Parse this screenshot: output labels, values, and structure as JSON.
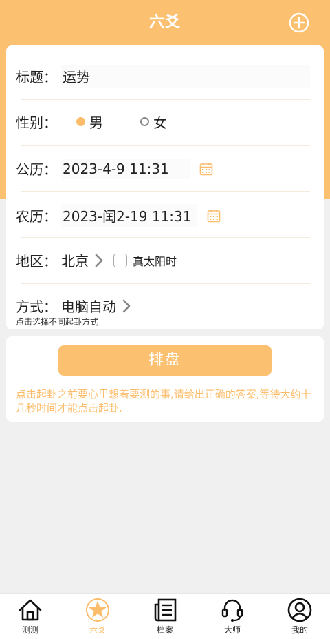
{
  "header": {
    "title": "六爻"
  },
  "form": {
    "title_label": "标题：",
    "title_value": "运势",
    "gender_label": "性别：",
    "gender_male": "男",
    "gender_female": "女",
    "solar_label": "公历：",
    "solar_value": "2023-4-9 11:31",
    "lunar_label": "农历：",
    "lunar_value": "2023-闰2-19 11:31",
    "region_label": "地区：",
    "region_value": "北京",
    "true_solar_label": "真太阳时",
    "method_label": "方式：",
    "method_value": "电脑自动",
    "method_hint": "点击选择不同起卦方式"
  },
  "action": {
    "button_label": "排盘",
    "notice": "点击起卦之前要心里想着要测的事,请给出正确的答案,等待大约十几秒时间才能点击起卦."
  },
  "tabs": [
    {
      "label": "测测",
      "icon": "home-icon"
    },
    {
      "label": "六爻",
      "icon": "star-icon"
    },
    {
      "label": "档案",
      "icon": "document-icon"
    },
    {
      "label": "大师",
      "icon": "headset-icon"
    },
    {
      "label": "我的",
      "icon": "profile-icon"
    }
  ],
  "colors": {
    "accent": "#fcc170",
    "accent_text": "#fbbd6b",
    "active_tab": "#fbbc6b"
  }
}
